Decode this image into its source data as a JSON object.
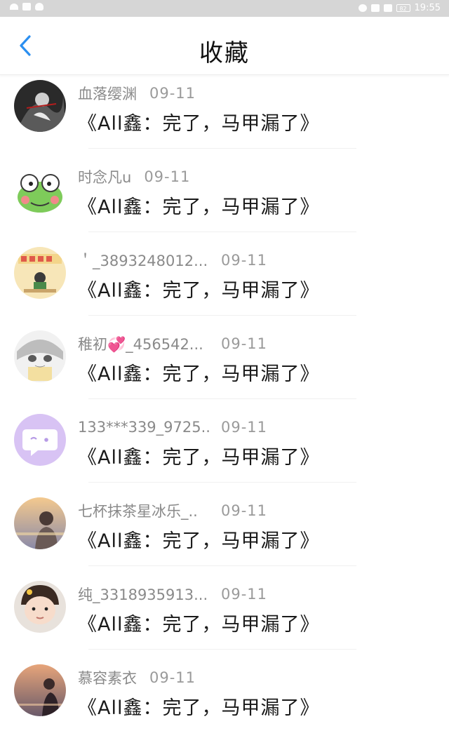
{
  "status_bar": {
    "time": "19:55",
    "battery": "82"
  },
  "header": {
    "title": "收藏",
    "back_label": "<"
  },
  "colors": {
    "accent": "#2b8ff0",
    "status_bar": "#d6d6d6"
  },
  "items": [
    {
      "username": "血落缨渊",
      "date": "09-11",
      "title": "《All鑫：完了，马甲漏了》",
      "avatar": "dark-anime-avatar"
    },
    {
      "username": "时念凡u",
      "date": "09-11",
      "title": "《All鑫：完了，马甲漏了》",
      "avatar": "frog-avatar"
    },
    {
      "username": "＇_3893248012...",
      "date": "09-11",
      "title": "《All鑫：完了，马甲漏了》",
      "avatar": "exam-success-avatar"
    },
    {
      "username": "稚初💞_456542...",
      "date": "09-11",
      "title": "《All鑫：完了，马甲漏了》",
      "avatar": "sketch-face-avatar"
    },
    {
      "username": "133***339_9725..",
      "date": "09-11",
      "title": "《All鑫：完了，马甲漏了》",
      "avatar": "purple-chat-avatar"
    },
    {
      "username": "七杯抹茶星冰乐_..",
      "date": "09-11",
      "title": "《All鑫：完了，马甲漏了》",
      "avatar": "sunset-girl-avatar"
    },
    {
      "username": "纯_3318935913...",
      "date": "09-11",
      "title": "《All鑫：完了，马甲漏了》",
      "avatar": "toddler-avatar"
    },
    {
      "username": "慕容素衣",
      "date": "09-11",
      "title": "《All鑫：完了，马甲漏了》",
      "avatar": "dusk-silhouette-avatar"
    }
  ]
}
